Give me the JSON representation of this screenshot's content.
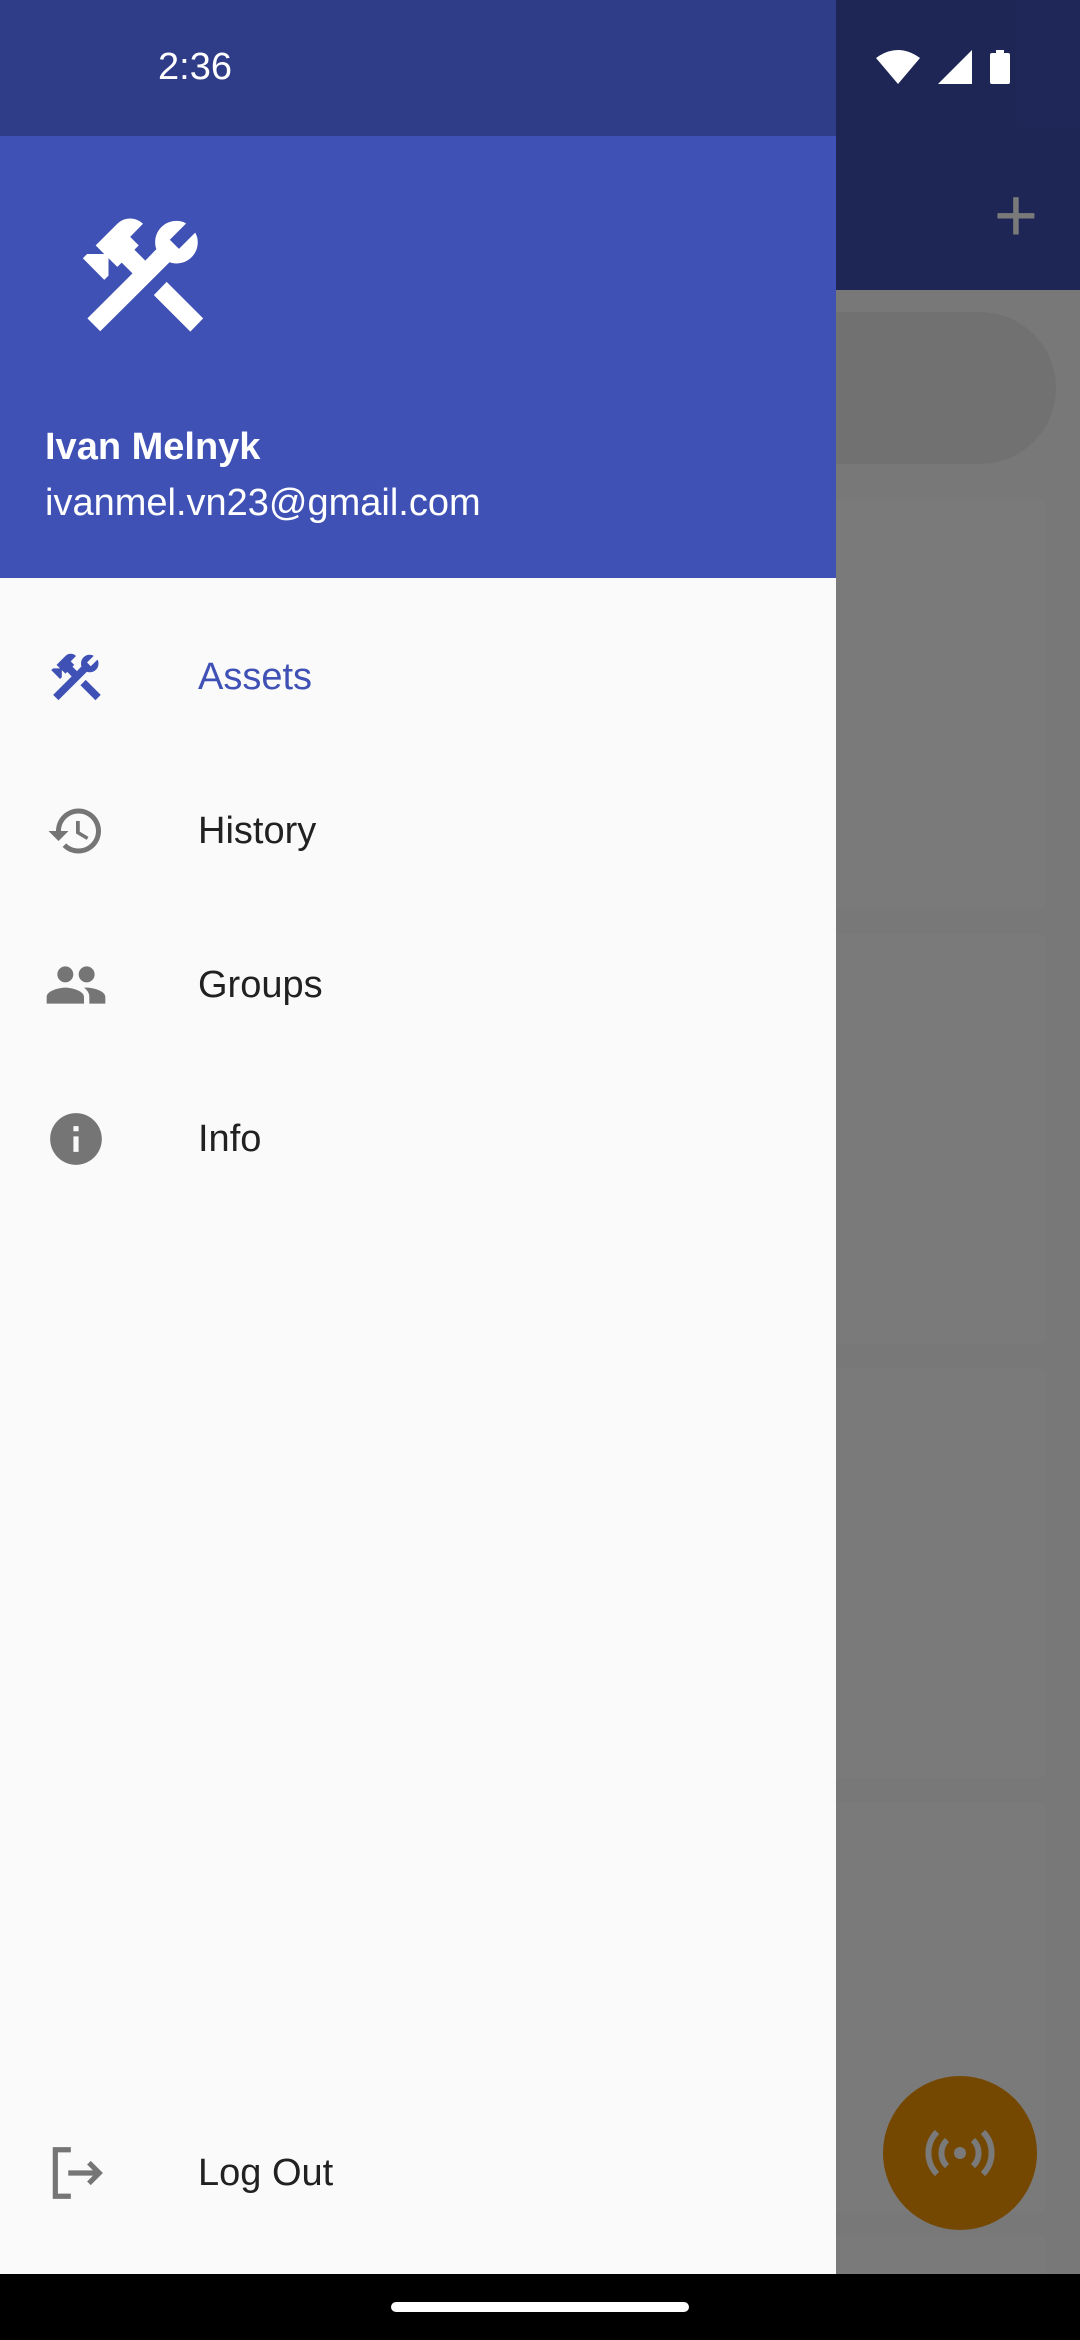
{
  "status_bar": {
    "time": "2:36"
  },
  "drawer": {
    "header": {
      "name": "Ivan Melnyk",
      "email": "ivanmel.vn23@gmail.com"
    },
    "items": [
      {
        "label": "Assets",
        "icon": "tools-icon",
        "active": true
      },
      {
        "label": "History",
        "icon": "history-icon",
        "active": false
      },
      {
        "label": "Groups",
        "icon": "groups-icon",
        "active": false
      },
      {
        "label": "Info",
        "icon": "info-icon",
        "active": false
      }
    ],
    "logout": {
      "label": "Log Out",
      "icon": "logout-icon"
    }
  },
  "colors": {
    "primary": "#3f51b5",
    "primary_dark": "#2f3c88",
    "accent": "#f29600",
    "icon_gray": "#757575",
    "drawer_bg": "#fafafa"
  }
}
